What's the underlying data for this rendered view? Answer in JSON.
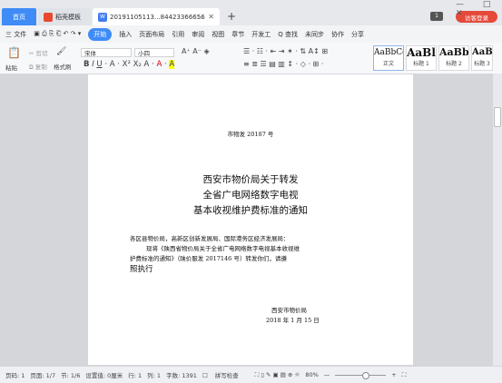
{
  "tabs": {
    "home": "首页",
    "templates": "稻壳模板",
    "document": "20191105113...84423366656",
    "visitor": "访客登录"
  },
  "window": {
    "badge": "1",
    "controls": "— □ ✕"
  },
  "menu": [
    "三 文件",
    "开始",
    "插入",
    "页面布局",
    "引用",
    "审阅",
    "视图",
    "章节",
    "开发工",
    "Q 查找",
    "未同步",
    "协作",
    "分享"
  ],
  "ribbon": {
    "paste": "粘贴",
    "cut": "剪切",
    "copy": "复制",
    "format_painter": "格式刷",
    "font_name": "宋体",
    "font_size": "小四",
    "styles": [
      {
        "sample": "AaBbCcI",
        "name": "正文"
      },
      {
        "sample": "AaBl",
        "name": "标题 1"
      },
      {
        "sample": "AaBb(",
        "name": "标题 2"
      },
      {
        "sample": "AaB",
        "name": "标题 3"
      }
    ]
  },
  "document": {
    "doc_number": "市物发 20187 号",
    "title_line1": "西安市物价局关于转发",
    "title_line2": "全省广电网络数字电视",
    "title_line3": "基本收视维护费标准的通知",
    "recipients": "各区县物价局，高新区创新发展局、国际港务区经济发展局：",
    "body_line1": "现将《陕西省物价局关于全省广电网络数字电视基本收视维",
    "body_line2": "护费标准的通知》（陕价服发 2017146 号）转发你们，请遵",
    "body_line3": "照执行",
    "signature": "西安市物价局",
    "date": "2018 年 1 月 15 日"
  },
  "status": {
    "page": "页码: 1",
    "pages": "页面: 1/7",
    "section": "节: 1/6",
    "setting": "设置值: 0厘米",
    "row": "行: 1",
    "col": "列: 1",
    "words": "字数: 1391",
    "spellcheck": "拼写检查",
    "zoom": "80%"
  }
}
